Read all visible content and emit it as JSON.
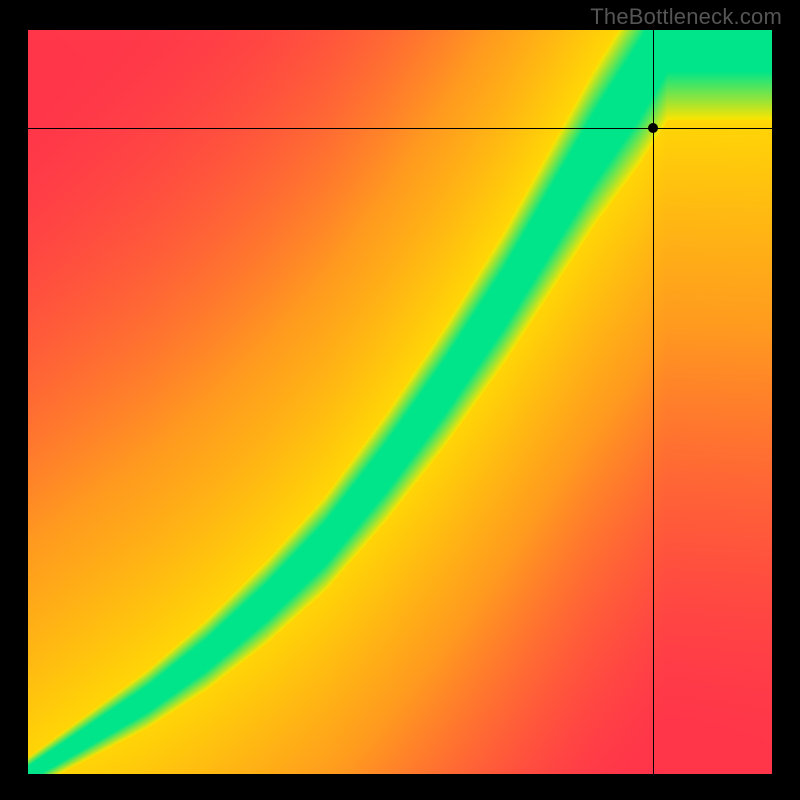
{
  "watermark": "TheBottleneck.com",
  "chart_data": {
    "type": "heatmap",
    "title": "",
    "xlabel": "",
    "ylabel": "",
    "xlim": [
      0,
      1
    ],
    "ylim": [
      0,
      1
    ],
    "legend": false,
    "ridge": {
      "description": "Green optimal-balance ridge path (normalized plot coords, origin bottom-left)",
      "points": [
        [
          0.0,
          0.0
        ],
        [
          0.08,
          0.05
        ],
        [
          0.16,
          0.1
        ],
        [
          0.24,
          0.16
        ],
        [
          0.32,
          0.23
        ],
        [
          0.4,
          0.31
        ],
        [
          0.48,
          0.41
        ],
        [
          0.56,
          0.52
        ],
        [
          0.64,
          0.64
        ],
        [
          0.7,
          0.74
        ],
        [
          0.76,
          0.84
        ],
        [
          0.82,
          0.93
        ],
        [
          0.86,
          1.0
        ]
      ],
      "half_width_start": 0.01,
      "half_width_end": 0.055
    },
    "crosshair": {
      "x": 0.84,
      "y": 0.868
    },
    "marker": {
      "x": 0.84,
      "y": 0.868
    },
    "colors": {
      "cold": "#ff2b4e",
      "warm": "#ff9a1f",
      "mid": "#ffe400",
      "good": "#00e58a"
    }
  }
}
